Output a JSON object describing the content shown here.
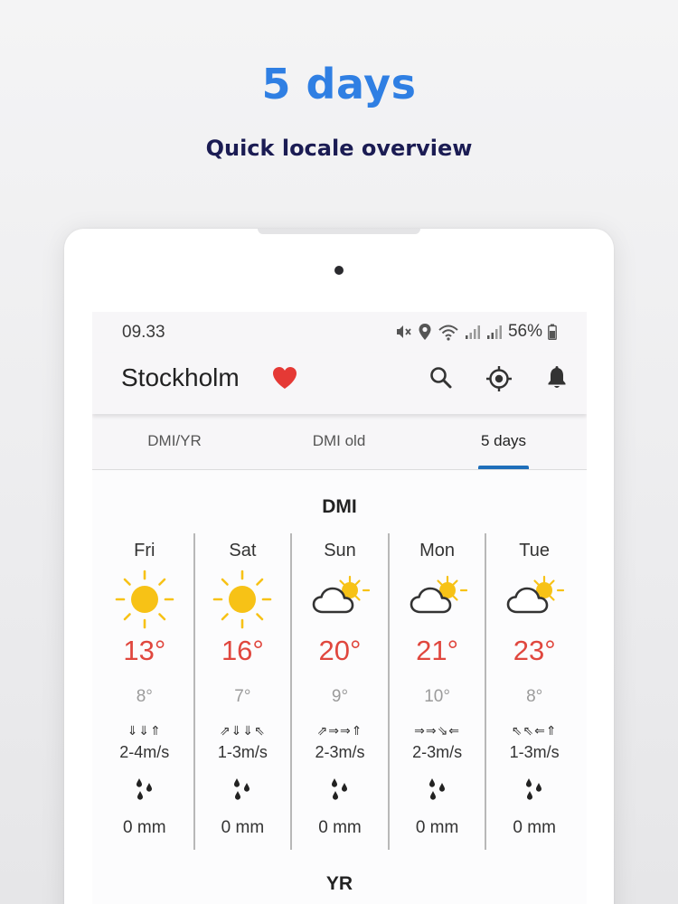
{
  "promo": {
    "title": "5 days",
    "subtitle": "Quick locale overview"
  },
  "status_bar": {
    "time": "09.33",
    "battery": "56%",
    "icons": [
      "mute-icon",
      "location-icon",
      "wifi-icon",
      "signal-icon",
      "signal-icon",
      "battery-icon"
    ]
  },
  "app_bar": {
    "city": "Stockholm",
    "icons": [
      "heart-icon",
      "search-icon",
      "locate-icon",
      "bell-icon"
    ]
  },
  "tabs": [
    {
      "label": "DMI/YR",
      "active": false
    },
    {
      "label": "DMI old",
      "active": false
    },
    {
      "label": "5 days",
      "active": true
    }
  ],
  "sections": [
    {
      "title": "DMI",
      "days": [
        {
          "name": "Fri",
          "icon": "sun-icon",
          "high": "13°",
          "low": "8°",
          "wind_dir": "⇓⇓⇑",
          "wind_speed": "2-4m/s",
          "rain": "0 mm"
        },
        {
          "name": "Sat",
          "icon": "sun-icon",
          "high": "16°",
          "low": "7°",
          "wind_dir": "⇗⇓⇓⇖",
          "wind_speed": "1-3m/s",
          "rain": "0 mm"
        },
        {
          "name": "Sun",
          "icon": "partly-cloudy-icon",
          "high": "20°",
          "low": "9°",
          "wind_dir": "⇗⇒⇒⇑",
          "wind_speed": "2-3m/s",
          "rain": "0 mm"
        },
        {
          "name": "Mon",
          "icon": "partly-cloudy-icon",
          "high": "21°",
          "low": "10°",
          "wind_dir": "⇒⇒⇘⇐",
          "wind_speed": "2-3m/s",
          "rain": "0 mm"
        },
        {
          "name": "Tue",
          "icon": "partly-cloudy-icon",
          "high": "23°",
          "low": "8°",
          "wind_dir": "⇖⇖⇐⇑",
          "wind_speed": "1-3m/s",
          "rain": "0 mm"
        }
      ]
    },
    {
      "title": "YR"
    }
  ],
  "colors": {
    "accent": "#2f7fe3",
    "subtitle": "#1b1c53",
    "temp_high": "#e0473e",
    "temp_low": "#9b9b9b",
    "tab_indicator": "#1f6fba",
    "heart": "#e53935",
    "sun": "#f7c216"
  }
}
